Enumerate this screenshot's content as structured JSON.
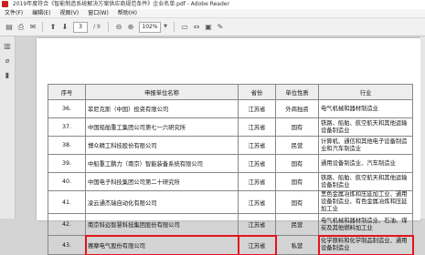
{
  "window": {
    "title": "2019年度符合《智能制造系统解决方案供应商规范条件》企业名单.pdf - Adobe Reader"
  },
  "menu": [
    "文件(F)",
    "编辑(E)",
    "视图(V)",
    "窗口(W)",
    "帮助(H)"
  ],
  "toolbar": {
    "page_current": "3",
    "page_total": "/ 9",
    "zoom": "102%"
  },
  "nav_icons": [
    "page-thumbnails-icon",
    "attachment-icon",
    "bookmark-icon"
  ],
  "table": {
    "headers": [
      "序号",
      "申报单位名称",
      "省份",
      "单位性质",
      "行业"
    ],
    "rows": [
      {
        "no": "36.",
        "name": "菲尼克斯（中国）投资有限公司",
        "prov": "江苏省",
        "type": "外商独资",
        "industry": "电气机械和器材制造业"
      },
      {
        "no": "37.",
        "name": "中国船舶重工集团公司第七一六研究所",
        "prov": "江苏省",
        "type": "国有",
        "industry": "铁路、船舶、航空航天和其他运输设备制造业"
      },
      {
        "no": "38.",
        "name": "博众精工科技股份有限公司",
        "prov": "江苏省",
        "type": "民营",
        "industry": "计算机、通信和其他电子设备制造业和汽车制造业"
      },
      {
        "no": "39.",
        "name": "中船重工鹏力（南京）智能装备系统有限公司",
        "prov": "江苏省",
        "type": "国有",
        "industry": "通用设备制造业、汽车制造业"
      },
      {
        "no": "40.",
        "name": "中国电子科技集团公司第二十研究所",
        "prov": "江苏省",
        "type": "国有",
        "industry": "铁路、船舶、航空航天和其他运输设备制造业"
      },
      {
        "no": "41.",
        "name": "凌云通杰瑞自动化有限公司",
        "prov": "江苏省",
        "type": "国有",
        "industry": "黑色金属冶炼和压延加工业、通用设备制造业、有色金属冶炼和压延加工业"
      },
      {
        "no": "42.",
        "name": "南京科远智慧科技集团股份有限公司",
        "prov": "江苏省",
        "type": "民营",
        "industry": "电气机械和器材制造业、石油、煤炭及其他燃料加工业"
      },
      {
        "no": "43.",
        "name": "赛摩电气股份有限公司",
        "prov": "江苏省",
        "type": "私营",
        "industry": "化学原料和化学制品制造业、通用设备制造业"
      }
    ]
  }
}
